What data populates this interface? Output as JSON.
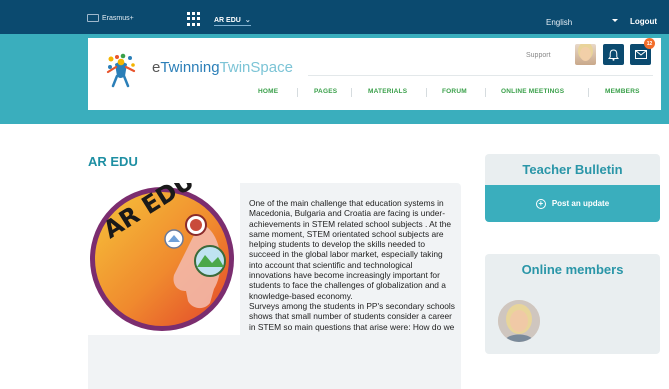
{
  "topbar": {
    "erasmus_label": "Erasmus+",
    "project_selector": "AR EDU",
    "language": "English",
    "logout_label": "Logout"
  },
  "header": {
    "logo_text_prefix": "e",
    "logo_text_twinning": "Twinning",
    "logo_text_twinspace": "TwinSpace",
    "support_label": "Support",
    "notification_count": "12",
    "nav": [
      "HOME",
      "PAGES",
      "MATERIALS",
      "FORUM",
      "ONLINE MEETINGS",
      "MEMBERS"
    ]
  },
  "main": {
    "title": "AR EDU",
    "image_text": "AR EDU",
    "description": "One of the main challenge that education systems in Macedonia, Bulgaria and Croatia are facing is under-achievements in STEM related school subjects . At the same moment, STEM orientated school subjects are helping students to develop the skills needed to succeed in the global labor market, especially taking into account that scientific and technological innovations have become increasingly important for students to face the challenges of globalization and a knowledge-based economy.\nSurveys among the students in PP's secondary schools shows that small number of students consider a career in STEM so main questions that arise were: How do we"
  },
  "sidebar": {
    "bulletin_title": "Teacher Bulletin",
    "post_update_label": "Post an update",
    "online_title": "Online members"
  },
  "colors": {
    "topbar": "#0b4a6f",
    "band": "#3aaebd",
    "nav_green": "#3aa04a",
    "title_teal": "#1e8fa3",
    "badge_orange": "#f26d2b"
  },
  "icons": [
    "eu-flag-icon",
    "apps-grid-icon",
    "chevron-down-icon",
    "caret-down-icon",
    "bell-icon",
    "mail-icon",
    "plus-circle-icon"
  ]
}
